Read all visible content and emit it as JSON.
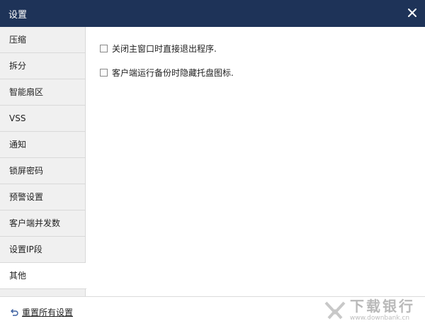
{
  "window": {
    "title": "设置",
    "close_icon": "close-icon"
  },
  "sidebar": {
    "items": [
      {
        "label": "压缩"
      },
      {
        "label": "拆分"
      },
      {
        "label": "智能扇区"
      },
      {
        "label": "VSS"
      },
      {
        "label": "通知"
      },
      {
        "label": "锁屏密码"
      },
      {
        "label": "预警设置"
      },
      {
        "label": "客户端并发数"
      },
      {
        "label": "设置IP段"
      },
      {
        "label": "其他",
        "active": true
      }
    ]
  },
  "options": [
    {
      "label": "关闭主窗口时直接退出程序.",
      "checked": false
    },
    {
      "label": "客户端运行备份时隐藏托盘图标.",
      "checked": false
    }
  ],
  "footer": {
    "reset_label": "重置所有设置",
    "reset_icon": "undo-arrow-icon"
  },
  "watermark": {
    "main": "下载银行",
    "sub": "www.downbank.cn"
  },
  "colors": {
    "titlebar": "#1e3358",
    "sidebar": "#efefef",
    "active_item": "#ffffff"
  }
}
